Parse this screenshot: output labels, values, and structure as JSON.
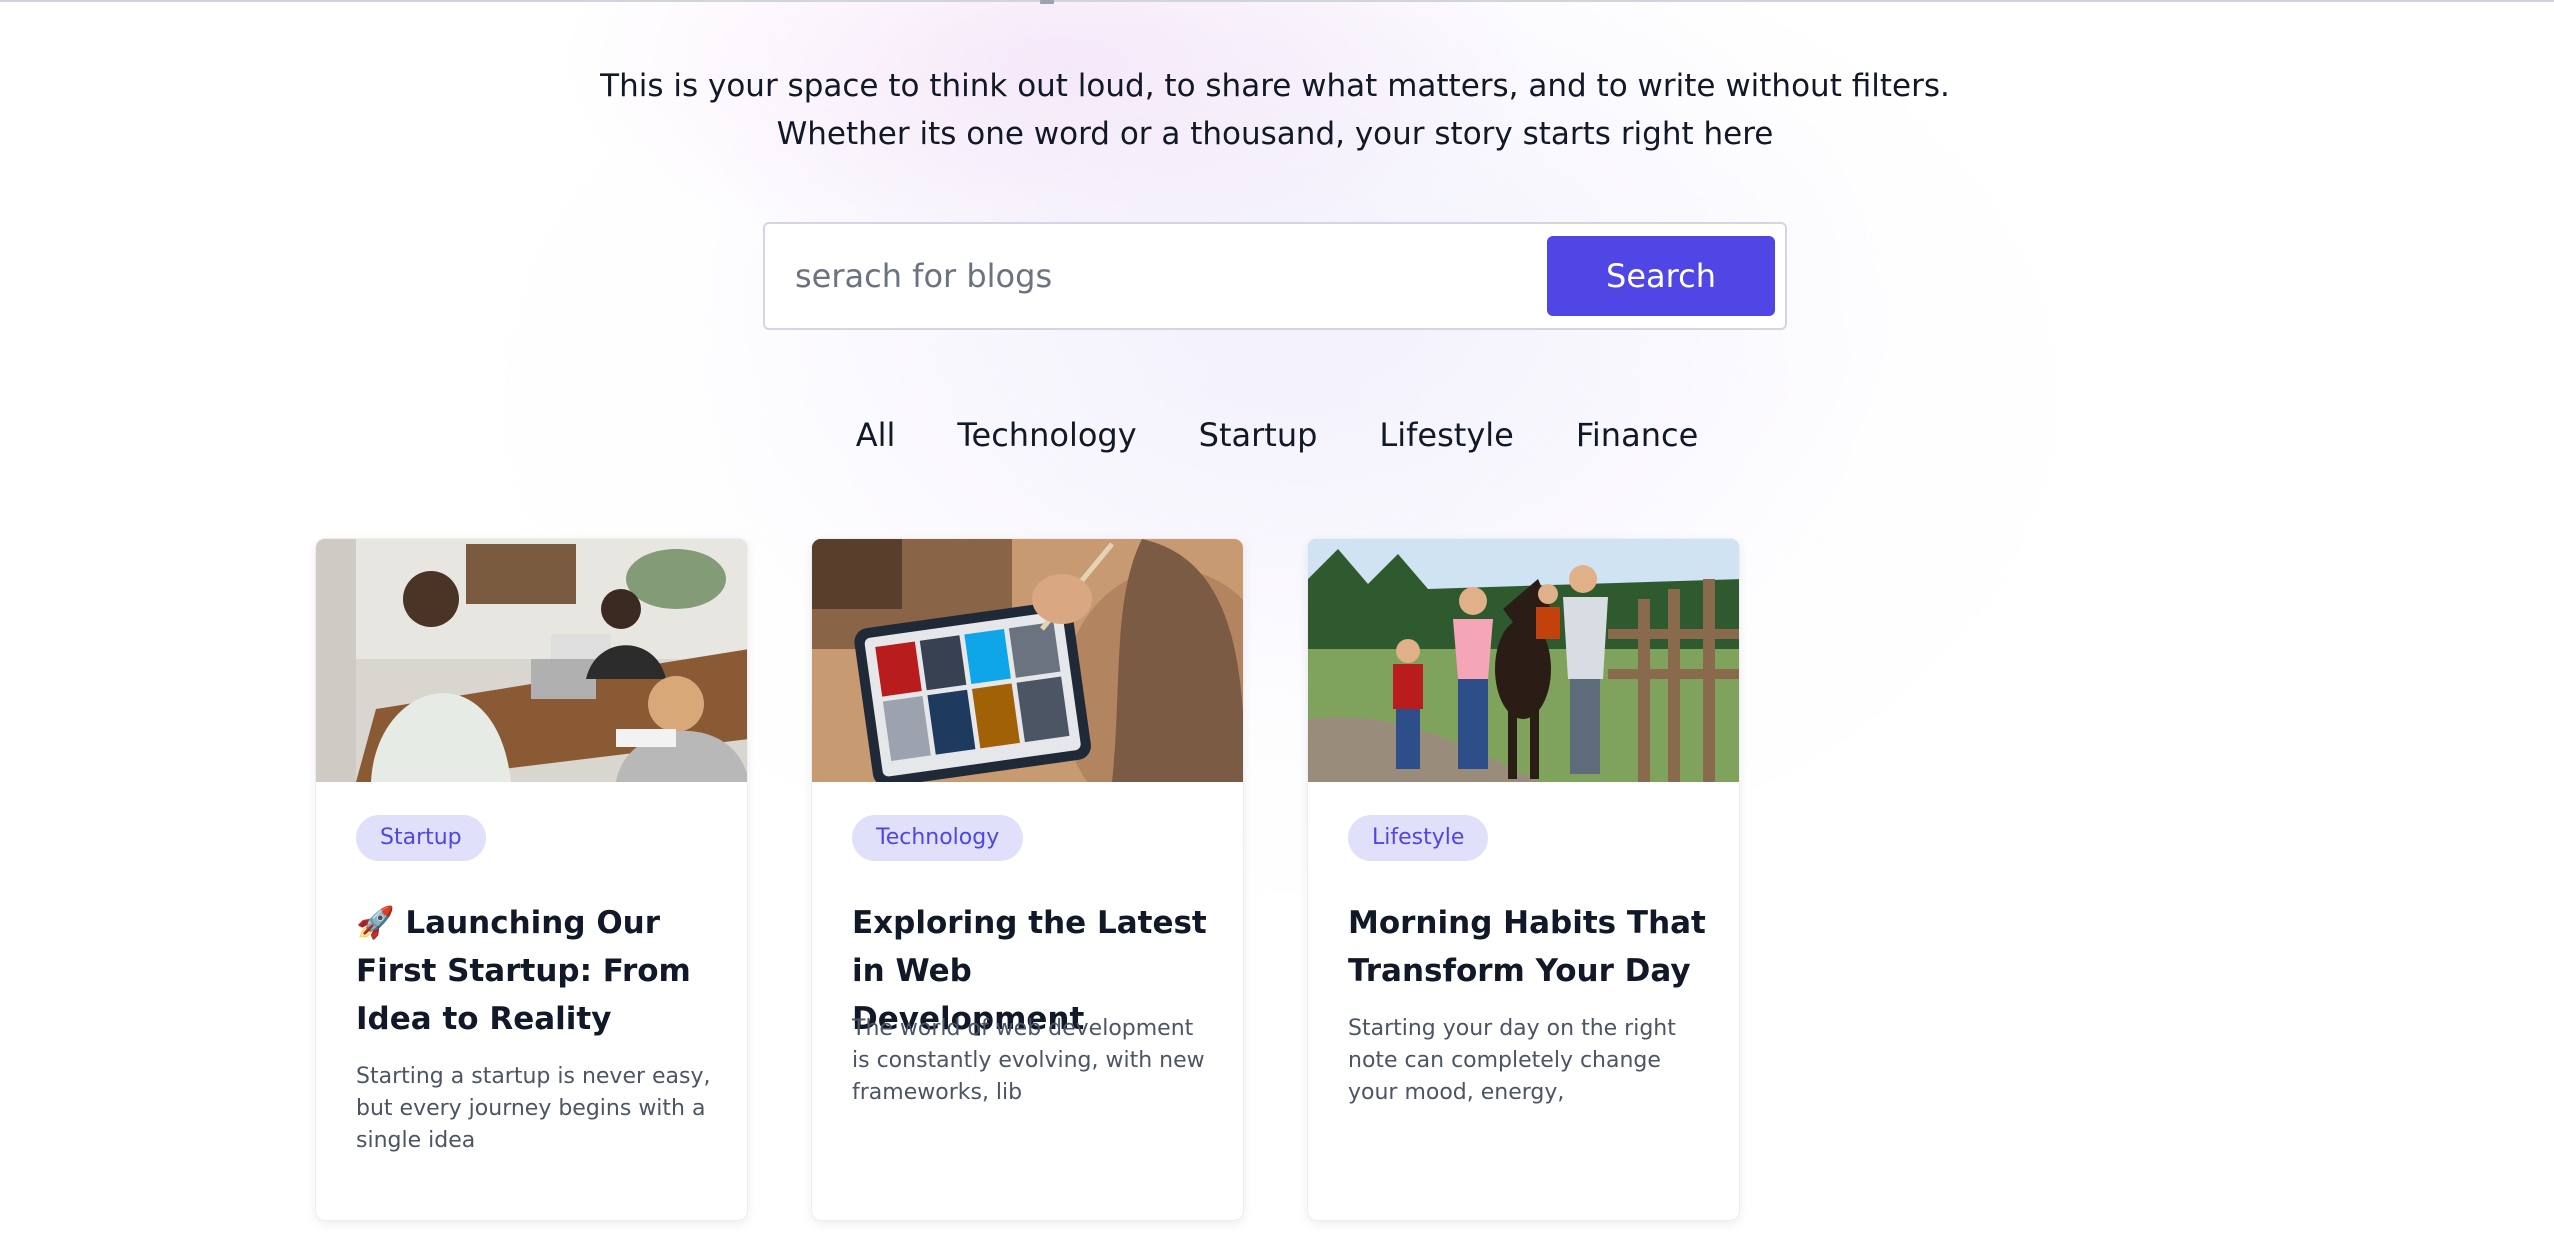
{
  "hero": {
    "tagline": "This is your space to think out loud, to share what matters, and to write without filters. Whether its one word or a thousand, your story starts right here"
  },
  "search": {
    "placeholder": "serach for blogs",
    "value": "",
    "button_label": "Search"
  },
  "filters": {
    "tabs": [
      {
        "label": "All"
      },
      {
        "label": "Technology"
      },
      {
        "label": "Startup"
      },
      {
        "label": "Lifestyle"
      },
      {
        "label": "Finance"
      }
    ]
  },
  "posts": [
    {
      "category": "Startup",
      "title": "🚀 Launching Our First Startup: From Idea to Reality",
      "excerpt": "Starting a startup is never easy, but every journey begins with a single idea",
      "image_icon": "office-meeting-photo"
    },
    {
      "category": "Technology",
      "title": "Exploring the Latest in Web Development",
      "excerpt": "The world of web development is constantly evolving, with new frameworks, lib",
      "image_icon": "tablet-design-photo"
    },
    {
      "category": "Lifestyle",
      "title": "Morning Habits That Transform Your Day",
      "excerpt": "Starting your day on the right note can completely change your mood, energy,",
      "image_icon": "family-horse-photo"
    }
  ],
  "colors": {
    "accent": "#4f46e5",
    "badge_bg": "#e0e0fb",
    "text": "#111827",
    "muted": "#4b5563"
  }
}
